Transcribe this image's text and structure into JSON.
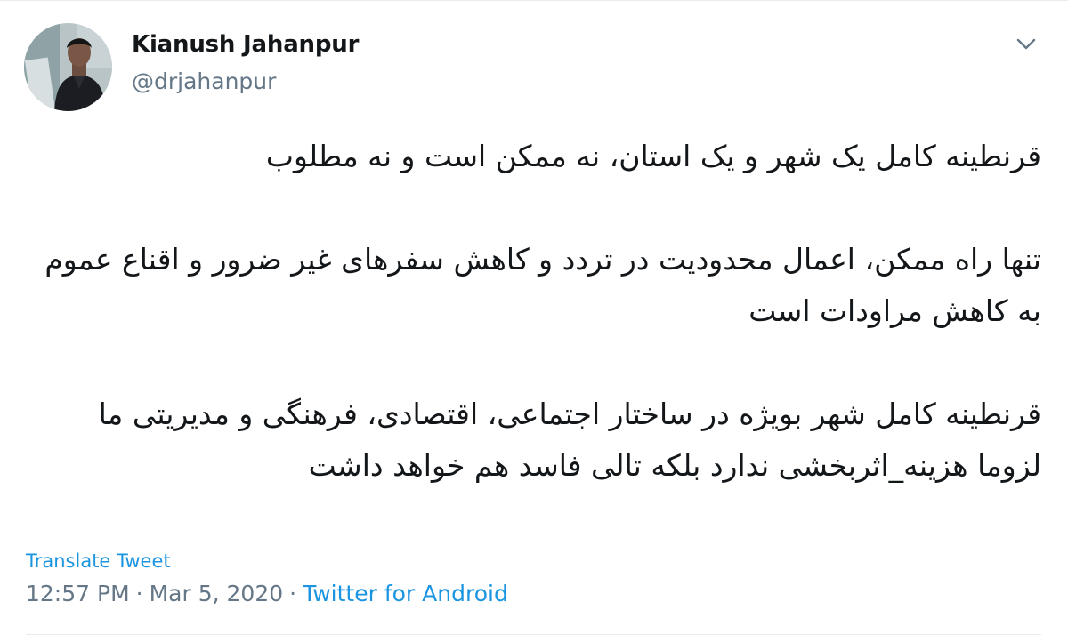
{
  "author": {
    "name": "Kianush Jahanpur",
    "handle": "@drjahanpur"
  },
  "tweet": {
    "paragraphs": [
      "قرنطینه کامل یک شهر و یک استان، نه ممکن است و نه مطلوب",
      "تنها راه ممکن، اعمال محدودیت در تردد و کاهش سفرهای غیر ضرور و اقناع عموم به کاهش مراودات است",
      "قرنطینه کامل شهر بویژه در ساختار اجتماعی، اقتصادی، فرهنگی و مدیریتی ما لزوما هزینه_اثربخشی ندارد بلکه تالی فاسد هم خواهد داشت"
    ]
  },
  "translate_label": "Translate Tweet",
  "meta": {
    "time": "12:57 PM",
    "separator": "·",
    "date": "Mar 5, 2020",
    "source": "Twitter for Android"
  },
  "icons": {
    "menu": "chevron-down-icon"
  },
  "colors": {
    "link": "#1b95e0",
    "secondary_text": "#657786",
    "primary_text": "#14171a"
  }
}
